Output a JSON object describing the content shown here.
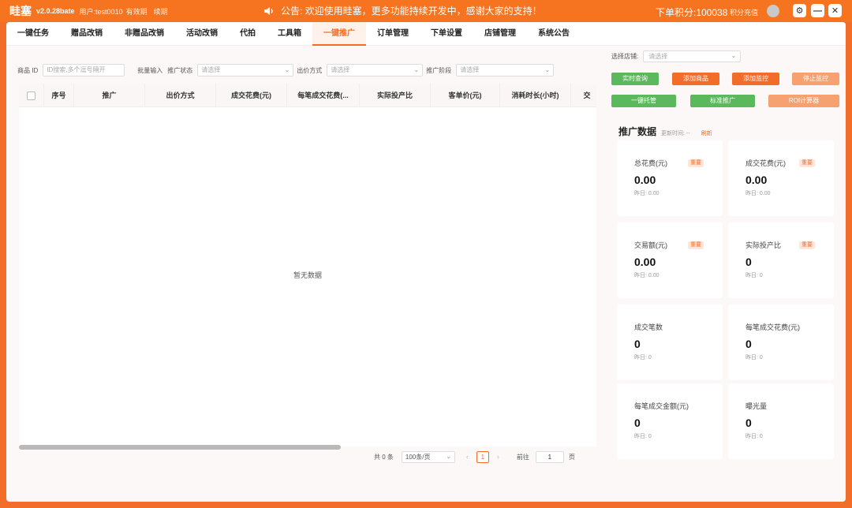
{
  "app": {
    "name": "畦塞",
    "version": "v2.0.28bate",
    "user": "用户:test0010",
    "status": "有效期",
    "renew": "续期",
    "notice": "公告: 欢迎使用畦塞，更多功能持续开发中，感谢大家的支持！",
    "points": "下单积分:100038",
    "recharge": "积分充值",
    "win_settings": "⚙",
    "win_min": "—",
    "win_close": "✕"
  },
  "tabs": [
    "一键任务",
    "赠品改销",
    "非赠品改销",
    "活动改销",
    "代拍",
    "工具箱",
    "一键推广",
    "订单管理",
    "下单设置",
    "店铺管理",
    "系统公告"
  ],
  "active_tab": 6,
  "filters": {
    "product_id_label": "商品 ID",
    "product_id_placeholder": "ID搜索,多个逗号隔开",
    "batch_input": "批量输入",
    "promo_status_label": "推广状态",
    "promo_status_placeholder": "请选择",
    "bid_method_label": "出价方式",
    "bid_method_placeholder": "请选择",
    "promo_stage_label": "推广阶段",
    "promo_stage_placeholder": "请选择"
  },
  "table": {
    "columns": [
      "序号",
      "推广",
      "出价方式",
      "成交花费(元)",
      "每笔成交花费(...",
      "实际投产比",
      "客单价(元)",
      "消耗时长(小时)",
      "交"
    ],
    "empty_text": "暂无数据"
  },
  "pager": {
    "total": "共 0 条",
    "page_size": "100条/页",
    "prev": "‹",
    "next": "›",
    "current": "1",
    "goto_label": "前往",
    "goto_value": "1",
    "page_unit": "页"
  },
  "side": {
    "store_label": "选择店铺:",
    "store_placeholder": "请选择",
    "buttons": {
      "realtime": "实时查询",
      "add_product": "添加商品",
      "add_monitor": "添加监控",
      "stop_monitor": "停止监控",
      "one_click_custody": "一键托管",
      "standard_promo": "标准推广",
      "roi_calc": "ROI计算器"
    },
    "stats_title": "推广数据",
    "update_time": "更新时间: --",
    "refresh": "刷新",
    "cards": [
      {
        "label": "总花费(元)",
        "tag": "重要",
        "value": "0.00",
        "yesterday": "昨日: 0.00"
      },
      {
        "label": "成交花费(元)",
        "tag": "重要",
        "value": "0.00",
        "yesterday": "昨日: 0.00"
      },
      {
        "label": "交易额(元)",
        "tag": "重要",
        "value": "0.00",
        "yesterday": "昨日: 0.00"
      },
      {
        "label": "实际投产比",
        "tag": "重要",
        "value": "0",
        "yesterday": "昨日: 0"
      },
      {
        "label": "成交笔数",
        "tag": "",
        "value": "0",
        "yesterday": "昨日: 0"
      },
      {
        "label": "每笔成交花费(元)",
        "tag": "",
        "value": "0",
        "yesterday": "昨日: 0"
      },
      {
        "label": "每笔成交金额(元)",
        "tag": "",
        "value": "0",
        "yesterday": "昨日: 0"
      },
      {
        "label": "曝光量",
        "tag": "",
        "value": "0",
        "yesterday": "昨日: 0"
      }
    ]
  }
}
